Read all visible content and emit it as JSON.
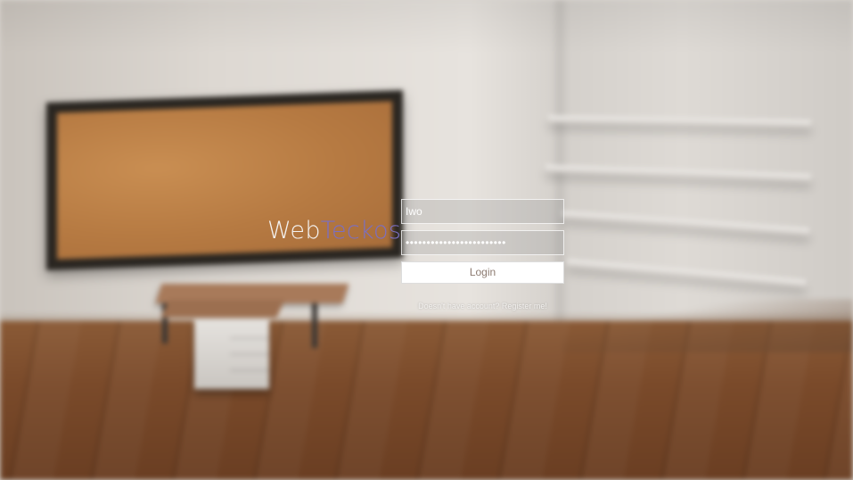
{
  "brand": {
    "part_1": "Web",
    "part_2": "Teckos"
  },
  "login_form": {
    "username_value": "Iwo",
    "password_value": "••••••••••••••••••••••••",
    "login_label": "Login",
    "register_text": "Doesn't have account? Register me!"
  },
  "colors": {
    "brand_primary": "#f4f2f0",
    "brand_accent": "#7b6fc2",
    "button_text": "#8c7a70"
  }
}
